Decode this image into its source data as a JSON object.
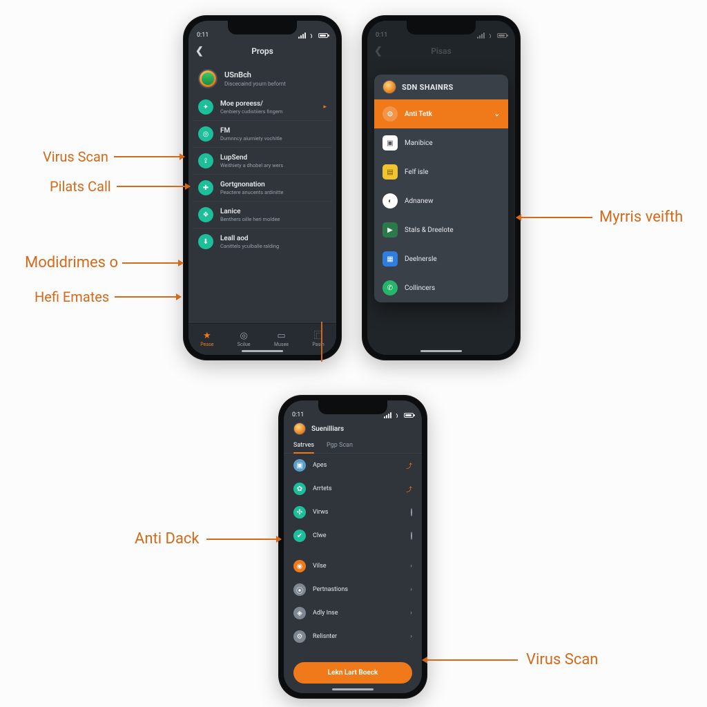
{
  "status": {
    "time": "0:11"
  },
  "phone1": {
    "title": "Props",
    "profile_name": "USnBch",
    "profile_sub": "Discecaind yourn befornt",
    "items": [
      {
        "title": "Moe poreess/",
        "sub": "Cenbiery cudistiiers fingem"
      },
      {
        "title": "FM",
        "sub": "Dumnncy aiurniety vochitle"
      },
      {
        "title": "LupSend",
        "sub": "Weithiety a dhobel ary wers"
      },
      {
        "title": "Gortgnonation",
        "sub": "Peactere anucents ardinitte"
      },
      {
        "title": "Lanice",
        "sub": "Benthers oille heri moldee"
      },
      {
        "title": "Leall aod",
        "sub": "Canittels yculballe ralding"
      }
    ],
    "tabs": [
      "Pease",
      "Scilue",
      "Musee",
      "Pasin"
    ]
  },
  "phone2": {
    "popup_title": "SDN SHAINRS",
    "selected": "Anti Tetk",
    "items": [
      "Manibice",
      "Felf isle",
      "Adnanew",
      "Stals & Dreelote",
      "Deelnersle",
      "Collincers"
    ]
  },
  "phone3": {
    "header": "Suenilliars",
    "tabs": [
      "Satrves",
      "Pgp Scan"
    ],
    "group1": [
      "Apes",
      "Arrtets",
      "Virws",
      "Clwe"
    ],
    "group2": [
      "Vilse",
      "Pertnastions",
      "Adly Inse",
      "Relisnter"
    ],
    "cta": "Lekn Lart Boeck"
  },
  "labels": {
    "l1": "Virus Scan",
    "l2": "Pilats Call",
    "l3": "Modidrimes o",
    "l4": "Hefi Emates",
    "r1": "Myrris veifth",
    "b1": "Anti Dack",
    "b2": "Virus Scan"
  },
  "colors": {
    "accent": "#f07a1a"
  }
}
